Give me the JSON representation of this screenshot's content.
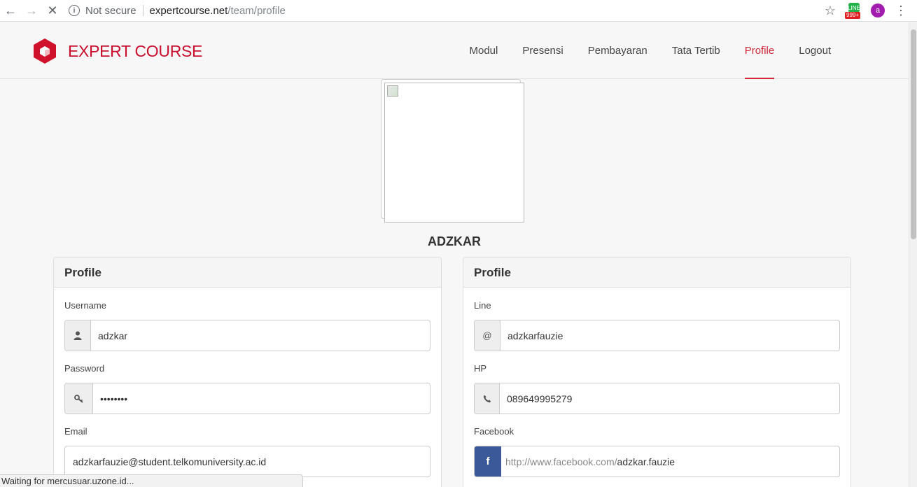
{
  "browser": {
    "security_label": "Not secure",
    "url_host": "expertcourse.net",
    "url_path": "/team/profile",
    "extension_badge": "999+",
    "extension_icon_text": "LINE",
    "profile_initial": "a"
  },
  "site": {
    "brand": "EXPERT COURSE",
    "brand_color": "#c8102e",
    "nav": [
      {
        "label": "Modul"
      },
      {
        "label": "Presensi"
      },
      {
        "label": "Pembayaran"
      },
      {
        "label": "Tata Tertib"
      },
      {
        "label": "Profile",
        "active": true
      },
      {
        "label": "Logout"
      }
    ]
  },
  "profile": {
    "name": "ADZKAR",
    "left_panel": {
      "title": "Profile",
      "username_label": "Username",
      "username_value": "adzkar",
      "password_label": "Password",
      "password_value": "••••••••",
      "email_label": "Email",
      "email_value": "adzkarfauzie@student.telkomuniversity.ac.id"
    },
    "right_panel": {
      "title": "Profile",
      "line_label": "Line",
      "line_addon": "@",
      "line_value": "adzkarfauzie",
      "hp_label": "HP",
      "hp_value": "089649995279",
      "facebook_label": "Facebook",
      "facebook_addon": "f",
      "facebook_prefix": "http://www.facebook.com/",
      "facebook_value": "adzkar.fauzie"
    }
  },
  "status_text": "Waiting for mercusuar.uzone.id..."
}
